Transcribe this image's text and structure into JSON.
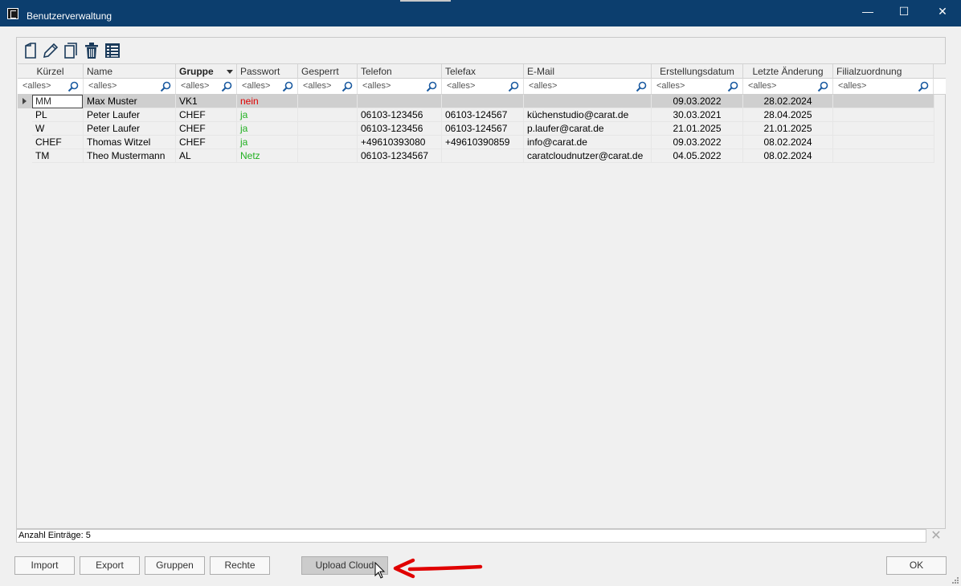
{
  "window": {
    "title": "Benutzerverwaltung",
    "controls": {
      "minimize": "—",
      "maximize": "☐",
      "close": "✕"
    }
  },
  "toolbar": {
    "icons": [
      "new-document-icon",
      "edit-pencil-icon",
      "copy-icon",
      "delete-trash-icon",
      "list-view-icon"
    ]
  },
  "columns": [
    {
      "label": "Kürzel"
    },
    {
      "label": "Name"
    },
    {
      "label": "Gruppe"
    },
    {
      "label": "Passwort"
    },
    {
      "label": "Gesperrt"
    },
    {
      "label": "Telefon"
    },
    {
      "label": "Telefax"
    },
    {
      "label": "E-Mail"
    },
    {
      "label": "Erstellungsdatum"
    },
    {
      "label": "Letzte Änderung"
    },
    {
      "label": "Filialzuordnung"
    }
  ],
  "filter": {
    "placeholder": "<alles>"
  },
  "rows": [
    {
      "kuerzel": "MM",
      "name": "Max Muster",
      "gruppe": "VK1",
      "passwort": "nein",
      "passwort_color": "#e00000",
      "gesperrt": "",
      "telefon": "",
      "telefax": "",
      "email": "",
      "erstellt": "09.03.2022",
      "geaendert": "28.02.2024",
      "filiale": "",
      "selected": true
    },
    {
      "kuerzel": "PL",
      "name": "Peter Laufer",
      "gruppe": "CHEF",
      "passwort": "ja",
      "passwort_color": "#20b020",
      "gesperrt": "",
      "telefon": "06103-123456",
      "telefax": "06103-124567",
      "email": "küchenstudio@carat.de",
      "erstellt": "30.03.2021",
      "geaendert": "28.04.2025",
      "filiale": ""
    },
    {
      "kuerzel": "W",
      "name": "Peter Laufer",
      "gruppe": "CHEF",
      "passwort": "ja",
      "passwort_color": "#20b020",
      "gesperrt": "",
      "telefon": "06103-123456",
      "telefax": "06103-124567",
      "email": "p.laufer@carat.de",
      "erstellt": "21.01.2025",
      "geaendert": "21.01.2025",
      "filiale": ""
    },
    {
      "kuerzel": "CHEF",
      "name": "Thomas Witzel",
      "gruppe": "CHEF",
      "passwort": "ja",
      "passwort_color": "#20b020",
      "gesperrt": "",
      "telefon": "+49610393080",
      "telefax": "+49610390859",
      "email": "info@carat.de",
      "erstellt": "09.03.2022",
      "geaendert": "08.02.2024",
      "filiale": ""
    },
    {
      "kuerzel": "TM",
      "name": "Theo Mustermann",
      "gruppe": "AL",
      "passwort": "Netz",
      "passwort_color": "#20b020",
      "gesperrt": "",
      "telefon": "06103-1234567",
      "telefax": "",
      "email": "caratcloudnutzer@carat.de",
      "erstellt": "04.05.2022",
      "geaendert": "08.02.2024",
      "filiale": ""
    }
  ],
  "status": {
    "text": "Anzahl Einträge: 5"
  },
  "buttons": {
    "import": "Import",
    "export": "Export",
    "gruppen": "Gruppen",
    "rechte": "Rechte",
    "upload_cloud": "Upload Cloud",
    "ok": "OK"
  },
  "annotation": {
    "arrow_color": "#e00000"
  }
}
